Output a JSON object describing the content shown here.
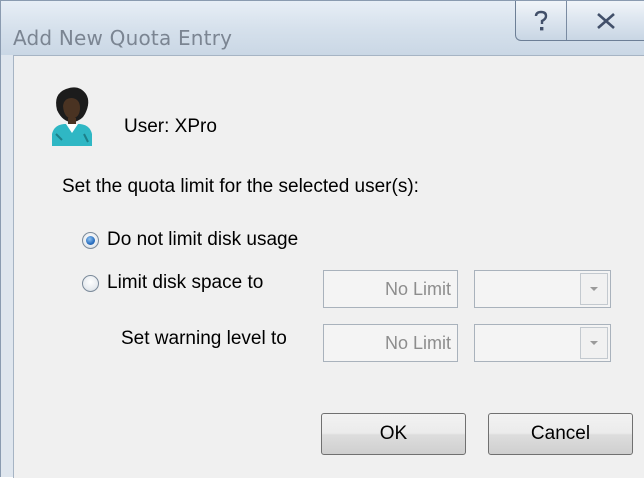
{
  "window": {
    "title": "Add New Quota Entry",
    "help_glyph": "?",
    "close_glyph": "✕"
  },
  "user": {
    "label": "User:  XPro",
    "icon": "user-avatar-icon"
  },
  "instructions": "Set the quota limit for the selected user(s):",
  "options": {
    "no_limit_label": "Do not limit disk usage",
    "no_limit_selected": true,
    "limit_label": "Limit disk space to",
    "limit_selected": false
  },
  "limit_value": "No Limit",
  "warning": {
    "label": "Set warning level to",
    "value": "No Limit"
  },
  "buttons": {
    "ok": "OK",
    "cancel": "Cancel"
  },
  "colors": {
    "title_text": "#7b8592",
    "disabled_text": "#8d8d8d",
    "radio_selected": "#2a6fc0"
  }
}
